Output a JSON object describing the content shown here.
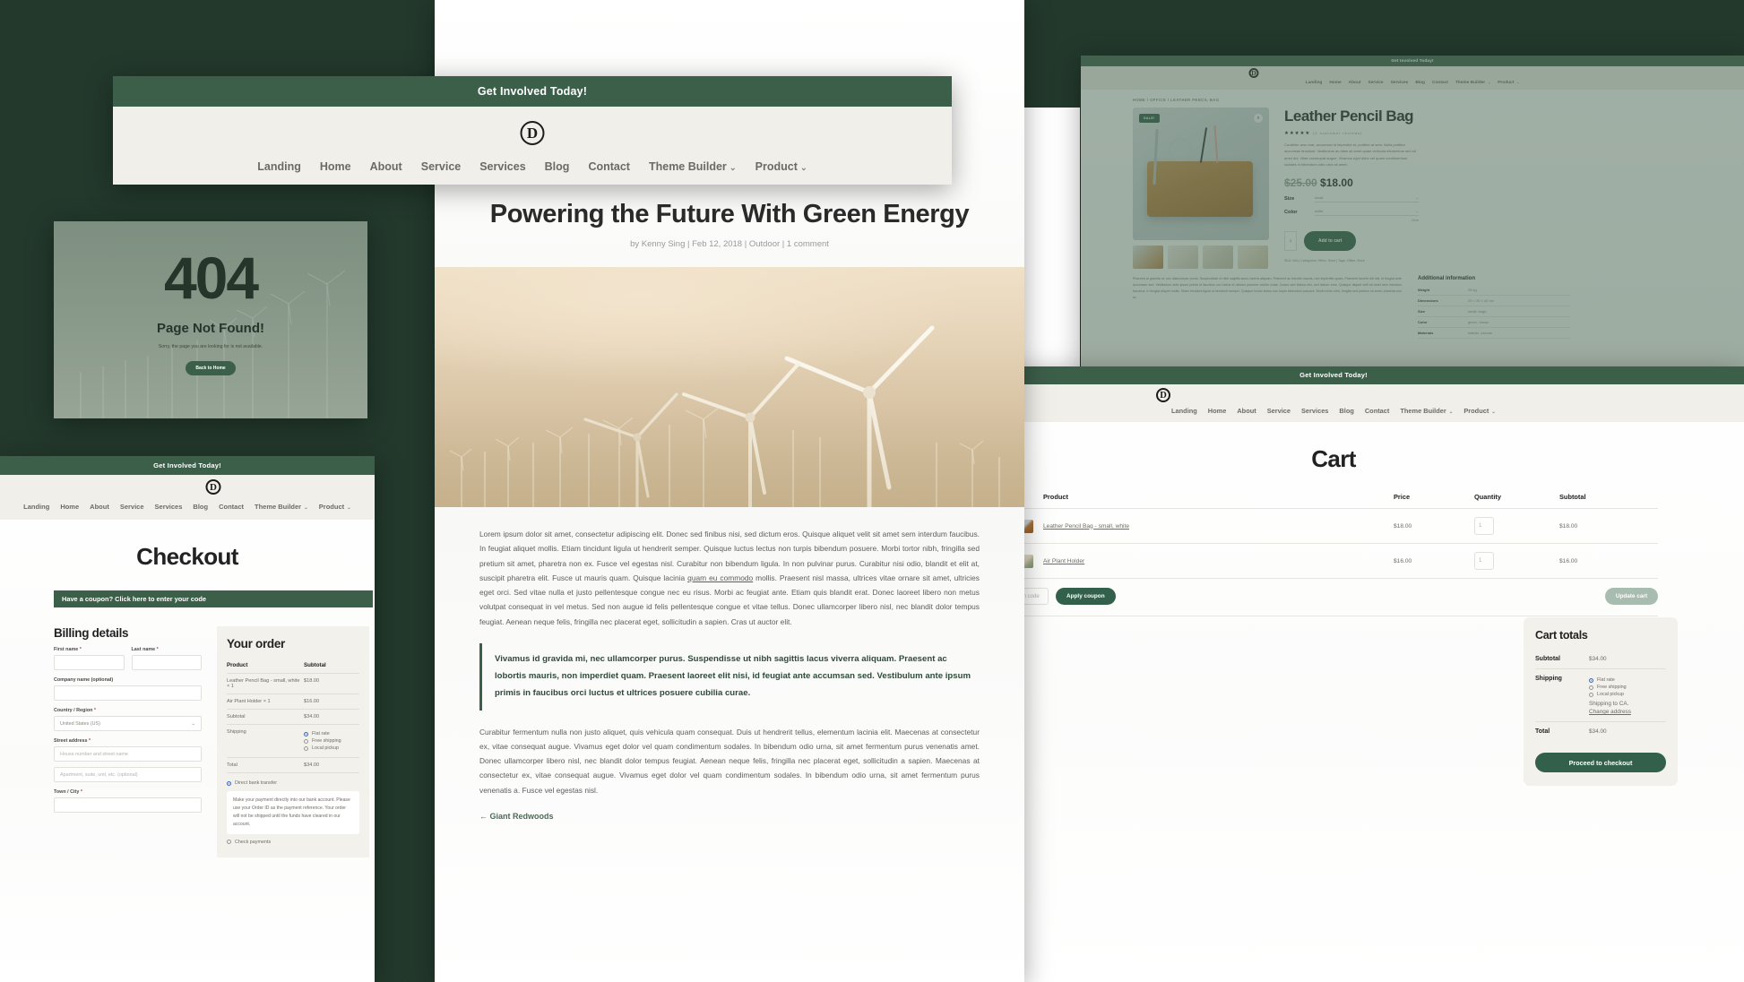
{
  "brand": {
    "logo_letter": "D",
    "accent": "#3c5f4a",
    "dark_bg": "#23392c"
  },
  "announcement": {
    "text": "Get Involved Today!"
  },
  "nav": {
    "items": [
      {
        "label": "Landing",
        "caret": false
      },
      {
        "label": "Home",
        "caret": false
      },
      {
        "label": "About",
        "caret": false
      },
      {
        "label": "Service",
        "caret": false
      },
      {
        "label": "Services",
        "caret": false
      },
      {
        "label": "Blog",
        "caret": false
      },
      {
        "label": "Contact",
        "caret": false
      },
      {
        "label": "Theme Builder",
        "caret": true
      },
      {
        "label": "Product",
        "caret": true
      }
    ],
    "caret_glyph": "⌄"
  },
  "post": {
    "title": "Powering the Future With Green Energy",
    "byline": "by Kenny Sing | Feb 12, 2018 | Outdoor | 1 comment",
    "paragraph_1": "Lorem ipsum dolor sit amet, consectetur adipiscing elit. Donec sed finibus nisi, sed dictum eros. Quisque aliquet velit sit amet sem interdum faucibus. In feugiat aliquet mollis. Etiam tincidunt ligula ut hendrerit semper. Quisque luctus lectus non turpis bibendum posuere. Morbi tortor nibh, fringilla sed pretium sit amet, pharetra non ex. Fusce vel egestas nisl. Curabitur non bibendum ligula. In non pulvinar purus. Curabitur nisi odio, blandit et elit at, suscipit pharetra elit. Fusce ut mauris quam. Quisque lacinia ",
    "paragraph_1_link": "quam eu commodo",
    "paragraph_1_rest": " mollis. Praesent nisl massa, ultrices vitae ornare sit amet, ultricies eget orci. Sed vitae nulla et justo pellentesque congue nec eu risus. Morbi ac feugiat ante. Etiam quis blandit erat. Donec laoreet libero non metus volutpat consequat in vel metus. Sed non augue id felis pellentesque congue et vitae tellus. Donec ullamcorper libero nisl, nec blandit dolor tempus feugiat. Aenean neque felis, fringilla nec placerat eget, sollicitudin a sapien. Cras ut auctor elit.",
    "quote": "Vivamus id gravida mi, nec ullamcorper purus. Suspendisse ut nibh sagittis lacus viverra aliquam. Praesent ac lobortis mauris, non imperdiet quam. Praesent laoreet elit nisi, id feugiat ante accumsan sed. Vestibulum ante ipsum primis in faucibus orci luctus et ultrices posuere cubilia curae.",
    "paragraph_2": "Curabitur fermentum nulla non justo aliquet, quis vehicula quam consequat. Duis ut hendrerit tellus, elementum lacinia elit. Maecenas at consectetur ex, vitae consequat augue. Vivamus eget dolor vel quam condimentum sodales. In bibendum odio urna, sit amet fermentum purus venenatis amet. Donec ullamcorper libero nisl, nec blandit dolor tempus feugiat. Aenean neque felis, fringilla nec placerat eget, sollicitudin a sapien. Maecenas at consectetur ex, vitae consequat augue. Vivamus eget dolor vel quam condimentum sodales. In bibendum odio urna, sit amet fermentum purus venenatis a. Fusce vel egestas nisl.",
    "prev_link": "← Giant Redwoods"
  },
  "error_page": {
    "code": "404",
    "heading": "Page Not Found!",
    "note": "Sorry, the page you are looking for is not available.",
    "button": "Back to Home"
  },
  "checkout": {
    "title": "Checkout",
    "coupon_bar": "Have a coupon? Click here to enter your code",
    "billing_heading": "Billing details",
    "fields": [
      {
        "label": "First name",
        "required": true,
        "value": "",
        "placeholder": ""
      },
      {
        "label": "Last name",
        "required": true,
        "value": "",
        "placeholder": ""
      },
      {
        "label": "Company name (optional)",
        "required": false,
        "value": "",
        "placeholder": ""
      },
      {
        "label": "Country / Region",
        "required": true,
        "value": "United States (US)",
        "placeholder": ""
      },
      {
        "label": "Street address",
        "required": true,
        "value": "",
        "placeholder": "House number and street name"
      },
      {
        "label": "",
        "required": false,
        "value": "",
        "placeholder": "Apartment, suite, unit, etc. (optional)"
      },
      {
        "label": "Town / City",
        "required": true,
        "value": "",
        "placeholder": ""
      }
    ],
    "order_heading": "Your order",
    "order_columns": [
      "Product",
      "Subtotal"
    ],
    "order_rows": [
      {
        "product": "Leather Pencil Bag - small, white  × 1",
        "subtotal": "$18.00"
      },
      {
        "product": "Air Plant Holder × 1",
        "subtotal": "$16.00"
      },
      {
        "product": "Subtotal",
        "subtotal": "$34.00"
      }
    ],
    "shipping_label": "Shipping",
    "shipping_options": [
      {
        "label": "Flat rate",
        "selected": true
      },
      {
        "label": "Free shipping",
        "selected": false
      },
      {
        "label": "Local pickup",
        "selected": false
      }
    ],
    "total_label": "Total",
    "total_value": "$34.00",
    "payment_methods": [
      {
        "label": "Direct bank transfer",
        "selected": true
      },
      {
        "label": "Check payments",
        "selected": false
      }
    ],
    "payment_note": "Make your payment directly into our bank account. Please use your Order ID as the payment reference. Your order will not be shipped until the funds have cleared in our account."
  },
  "cart": {
    "title": "Cart",
    "columns": [
      "Product",
      "Price",
      "Quantity",
      "Subtotal"
    ],
    "rows": [
      {
        "remove": "×",
        "thumb": "bag",
        "name": "Leather Pencil Bag - small, white",
        "price": "$18.00",
        "qty": "1",
        "subtotal": "$18.00"
      },
      {
        "remove": "×",
        "thumb": "plant",
        "name": "Air Plant Holder",
        "price": "$16.00",
        "qty": "1",
        "subtotal": "$16.00"
      }
    ],
    "coupon_placeholder": "Coupon code",
    "apply_coupon": "Apply coupon",
    "update_cart": "Update cart",
    "totals_heading": "Cart totals",
    "subtotal_label": "Subtotal",
    "subtotal_value": "$34.00",
    "shipping_label": "Shipping",
    "shipping_options": [
      {
        "label": "Flat rate",
        "selected": true
      },
      {
        "label": "Free shipping",
        "selected": false
      },
      {
        "label": "Local pickup",
        "selected": false
      }
    ],
    "shipping_to": "Shipping to CA.",
    "change_address": "Change address",
    "total_label": "Total",
    "total_value": "$34.00",
    "proceed_button": "Proceed to checkout"
  },
  "product": {
    "breadcrumb": "HOME / OFFICE / LEATHER PENCIL BAG",
    "sale_badge": "SALE!",
    "title": "Leather Pencil Bag",
    "stars": "★★★★★",
    "reviews": "(2 customer reviews)",
    "description": "Curabitur arcu erat, accumsan id imperdiet et, porttitor at sem. Nulla porttitor accumsan tincidunt. Vestibulum ac diam sit amet quam vehicula elementum sed sit amet dui. Vitae consequat augue. Vivamus eget dolor vel quam condimentum sodales in bibendum odio urna sit amet.",
    "price_old": "$25.00",
    "price_new": "$18.00",
    "attributes": [
      {
        "label": "Size",
        "value": "small"
      },
      {
        "label": "Color",
        "value": "white"
      }
    ],
    "clear": "Clear",
    "qty": "1",
    "add_to_cart": "Add to cart",
    "sku_line": "SKU: N/A  |  Categories: Office, Store  |  Tags: Office, Store",
    "long_description": "Pharetra at gravida ut, nec ullamcorper purus. Suspendisse ut nibh sagittis lacus viverra aliquam. Praesent ac lobortis mauris, non imperdiet quam. Praesent laoreet elit nisi, id feugiat ante accumsan sed. Vestibulum ante ipsum primis in faucibus orci luctus et ultrices posuere cubilia curae. Donec sed finibus nisi, sed dictum eros. Quisque aliquet velit sit amet sem interdum faucibus. In feugiat aliquet mollis. Etiam tincidunt ligula ut hendrerit semper. Quisque luctus lectus non turpis bibendum posuere. Morbi tortor nibh, fringilla sed pretium sit amet, pharetra non ex.",
    "addinfo_heading": "Additional information",
    "addinfo_rows": [
      {
        "key": "Weight",
        "value": "25 kg"
      },
      {
        "key": "Dimensions",
        "value": "20 × 20 × 40 cm"
      },
      {
        "key": "Size",
        "value": "small, large"
      },
      {
        "key": "Color",
        "value": "green, brown"
      },
      {
        "key": "Materials",
        "value": "leather, canvas"
      }
    ]
  }
}
